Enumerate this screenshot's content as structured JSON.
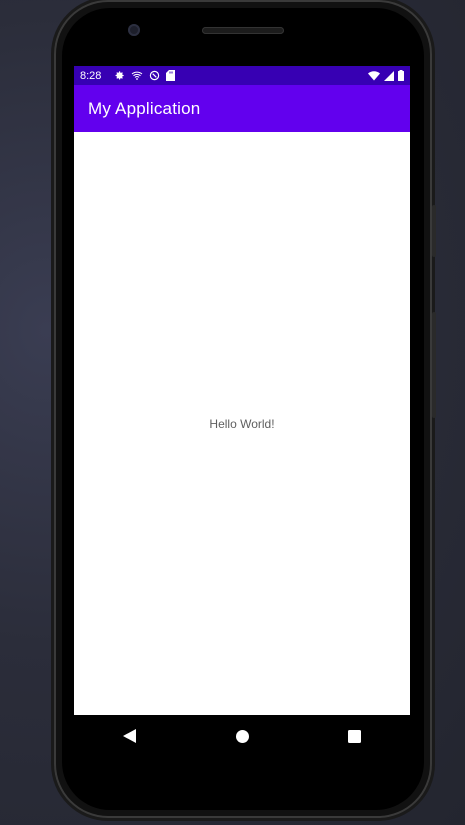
{
  "status_bar": {
    "time": "8:28",
    "left_icons": [
      "gear-icon",
      "wifi-question-icon",
      "sync-icon",
      "sd-card-icon"
    ],
    "right_icons": [
      "wifi-icon",
      "signal-icon",
      "battery-icon"
    ],
    "color": "#3700b3"
  },
  "app_bar": {
    "title": "My Application",
    "color": "#6200ee"
  },
  "main": {
    "text": "Hello World!"
  },
  "nav_bar": {
    "buttons": [
      "back-icon",
      "home-icon",
      "recents-icon"
    ]
  }
}
